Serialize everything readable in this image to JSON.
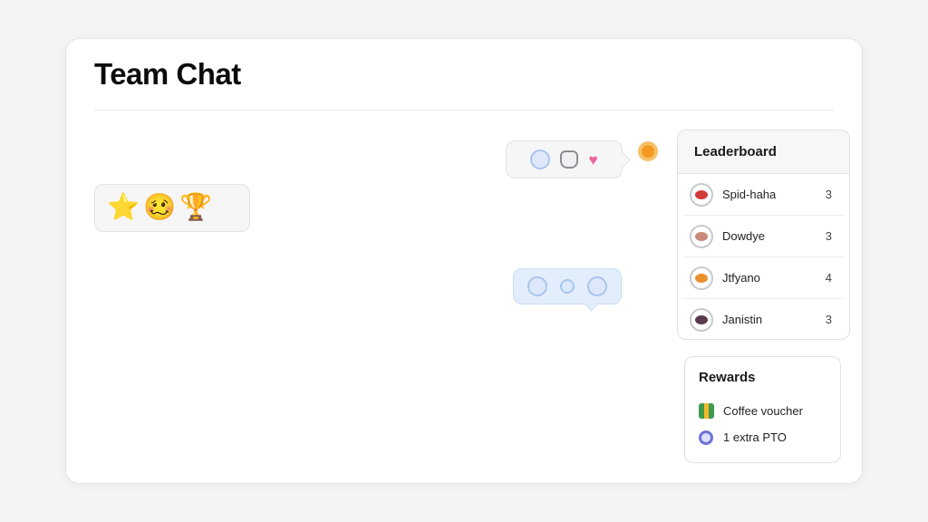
{
  "header": {
    "title": "Team Chat"
  },
  "messages": {
    "left_emojis": [
      "⭐",
      "🥴",
      "🏆"
    ]
  },
  "leaderboard": {
    "title": "Leaderboard",
    "rows": [
      {
        "name": "Spid-haha",
        "score": "3",
        "avatar_color": "#d33a3a"
      },
      {
        "name": "Dowdye",
        "score": "3",
        "avatar_color": "#c88a7a"
      },
      {
        "name": "Jtfyano",
        "score": "4",
        "avatar_color": "#e8902c"
      },
      {
        "name": "Janistin",
        "score": "3",
        "avatar_color": "#5a3a4a"
      }
    ]
  },
  "rewards": {
    "title": "Rewards",
    "items": [
      {
        "label": "Coffee voucher",
        "icon": "gift-icon"
      },
      {
        "label": "1 extra PTO",
        "icon": "chat-icon"
      }
    ]
  },
  "colors": {
    "accent_blue": "#a9c4ee",
    "heart": "#e8679a",
    "notification": "#f59a21"
  }
}
